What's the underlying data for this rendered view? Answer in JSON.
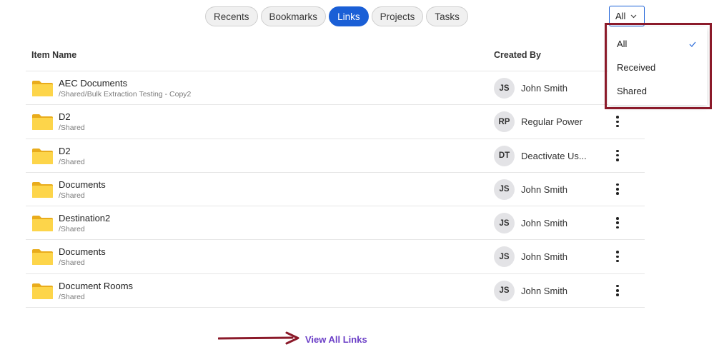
{
  "tabs": [
    {
      "label": "Recents",
      "active": false
    },
    {
      "label": "Bookmarks",
      "active": false
    },
    {
      "label": "Links",
      "active": true
    },
    {
      "label": "Projects",
      "active": false
    },
    {
      "label": "Tasks",
      "active": false
    }
  ],
  "filter": {
    "selected": "All",
    "options": [
      "All",
      "Received",
      "Shared"
    ]
  },
  "table": {
    "headers": {
      "item_name": "Item Name",
      "created_by": "Created By"
    },
    "rows": [
      {
        "name": "AEC Documents",
        "path": "/Shared/Bulk Extraction Testing - Copy2",
        "initials": "JS",
        "creator": "John Smith"
      },
      {
        "name": "D2",
        "path": "/Shared",
        "initials": "RP",
        "creator": "Regular Power"
      },
      {
        "name": "D2",
        "path": "/Shared",
        "initials": "DT",
        "creator": "Deactivate Us..."
      },
      {
        "name": "Documents",
        "path": "/Shared",
        "initials": "JS",
        "creator": "John Smith"
      },
      {
        "name": "Destination2",
        "path": "/Shared",
        "initials": "JS",
        "creator": "John Smith"
      },
      {
        "name": "Documents",
        "path": "/Shared",
        "initials": "JS",
        "creator": "John Smith"
      },
      {
        "name": "Document Rooms",
        "path": "/Shared",
        "initials": "JS",
        "creator": "John Smith"
      }
    ]
  },
  "footer": {
    "view_all_label": "View All Links"
  },
  "colors": {
    "accent": "#1a5fd6",
    "folder": "#fbcd45",
    "link": "#6b3fc7",
    "highlight": "#8b1a2a"
  },
  "icons": {
    "folder": "folder-icon",
    "more": "more-vertical-icon",
    "chevron": "chevron-down-icon",
    "check": "check-icon",
    "arrow": "arrow-right-icon"
  }
}
